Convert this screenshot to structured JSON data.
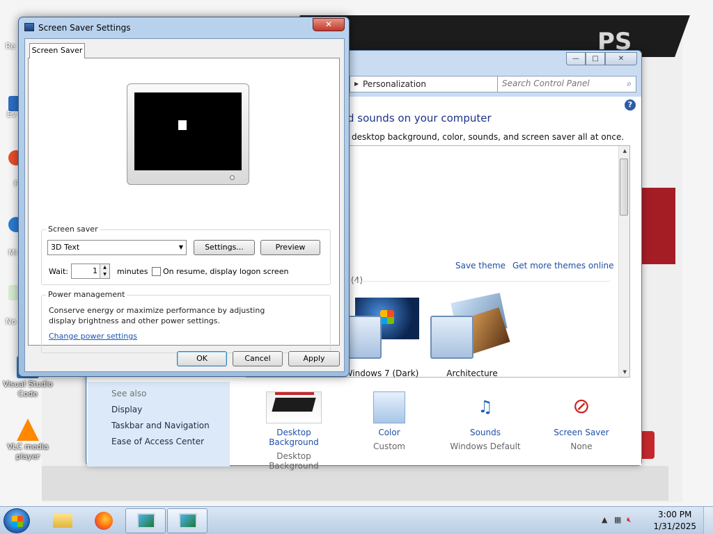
{
  "desktop": {
    "icons": [
      {
        "label": "Visual Studio Code"
      },
      {
        "label": "VLC media player"
      }
    ],
    "edge_fragments": [
      "Re",
      "Ev",
      "F",
      "Mi",
      "No"
    ]
  },
  "personalization": {
    "breadcrumb": "Personalization",
    "search_placeholder": "Search Control Panel",
    "heading": "d sounds on your computer",
    "subheading": "desktop background, color, sounds, and screen saver all at once.",
    "save_theme": "Save theme",
    "get_more_themes": "Get more themes online",
    "themes_count_fragment": "(4)",
    "themes": [
      {
        "label": "Windows 7 (Dark)"
      },
      {
        "label": "Architecture"
      }
    ],
    "see_also": {
      "heading": "See also",
      "items": [
        "Display",
        "Taskbar and Navigation",
        "Ease of Access Center"
      ]
    },
    "bottom_items": [
      {
        "link": "Desktop Background",
        "sub": "Desktop Background"
      },
      {
        "link": "Color",
        "sub": "Custom"
      },
      {
        "link": "Sounds",
        "sub": "Windows Default"
      },
      {
        "link": "Screen Saver",
        "sub": "None"
      }
    ]
  },
  "screensaver": {
    "title": "Screen Saver Settings",
    "tab": "Screen Saver",
    "group_screensaver": "Screen saver",
    "selected": "3D Text",
    "settings_button": "Settings...",
    "preview_button": "Preview",
    "wait_label": "Wait:",
    "wait_value": "1",
    "minutes_label": "minutes",
    "resume_label": "On resume, display logon screen",
    "resume_checked": false,
    "group_power": "Power management",
    "power_text": "Conserve energy or maximize performance by adjusting display brightness and other power settings.",
    "power_link": "Change power settings",
    "ok": "OK",
    "cancel": "Cancel",
    "apply": "Apply"
  },
  "taskbar": {
    "time": "3:00 PM",
    "date": "1/31/2025"
  },
  "colors": {
    "link": "#1e4fa7",
    "heading": "#1e3287",
    "close": "#c0392b",
    "seealso_bg": "#dce9f8"
  }
}
